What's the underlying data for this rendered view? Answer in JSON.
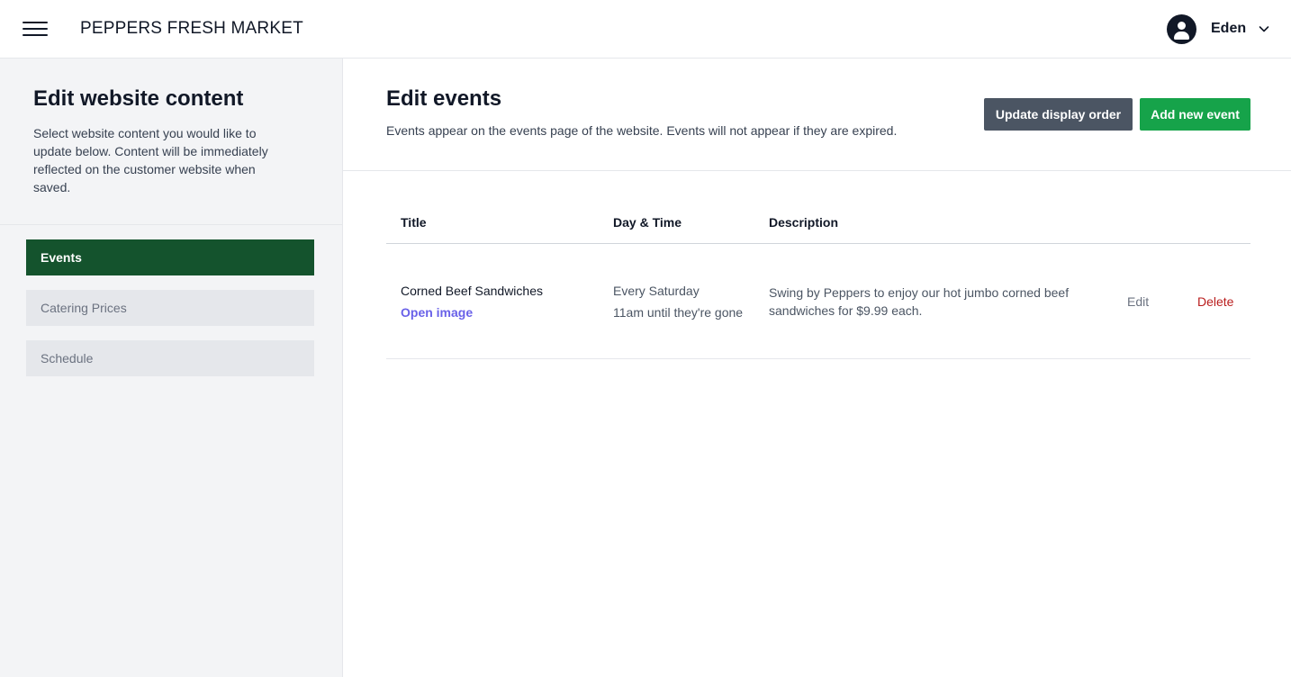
{
  "header": {
    "brand": "PEPPERS FRESH MARKET",
    "user_name": "Eden"
  },
  "sidebar": {
    "title": "Edit website content",
    "description": "Select website content you would like to update below. Content will be immediately reflected on the customer website when saved.",
    "items": [
      {
        "label": "Events",
        "active": true
      },
      {
        "label": "Catering Prices",
        "active": false
      },
      {
        "label": "Schedule",
        "active": false
      }
    ]
  },
  "main": {
    "title": "Edit events",
    "description": "Events appear on the events page of the website. Events will not appear if they are expired.",
    "update_order_label": "Update display order",
    "add_event_label": "Add new event",
    "columns": [
      "Title",
      "Day & Time",
      "Description"
    ],
    "events": [
      {
        "title": "Corned Beef Sandwiches",
        "image_link": "Open image",
        "day": "Every Saturday",
        "time": "11am until they're gone",
        "description": "Swing by Peppers to enjoy our hot jumbo corned beef sandwiches for $9.99 each.",
        "edit_label": "Edit",
        "delete_label": "Delete"
      }
    ]
  },
  "colors": {
    "active_nav": "#14532d",
    "update_button": "#4b5563",
    "add_button": "#16a34a",
    "link": "#4f46e5",
    "delete": "#b91c1c"
  },
  "icons": {
    "menu": "hamburger-menu-icon",
    "user": "user-avatar-icon",
    "dropdown": "chevron-down-icon"
  }
}
